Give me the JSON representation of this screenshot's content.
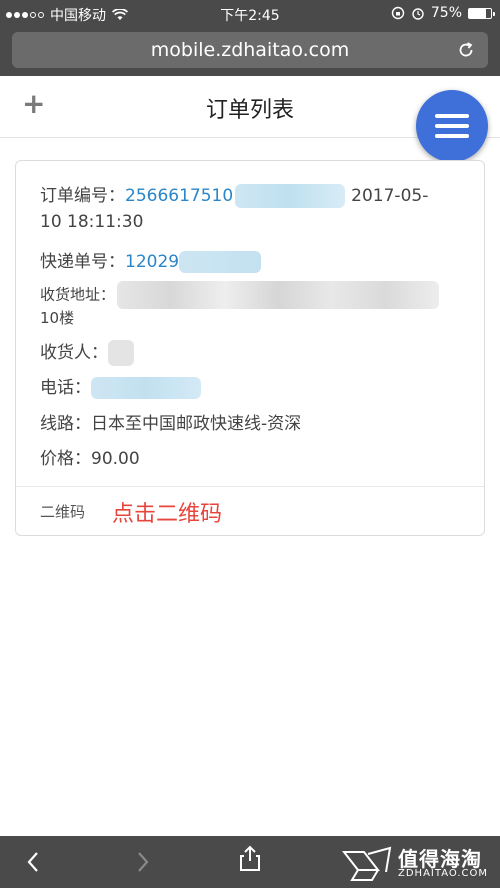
{
  "status_bar": {
    "carrier": "中国移动",
    "time": "下午2:45",
    "battery": "75%",
    "battery_level": 0.75
  },
  "browser": {
    "url": "mobile.zdhaitao.com"
  },
  "header": {
    "title": "订单列表"
  },
  "order": {
    "order_no_label": "订单编号：",
    "order_no_value": "2566617510",
    "order_time_part1": "2017-05-",
    "order_time_part2": "10 18:11:30",
    "express_label": "快递单号：",
    "express_value": "12029",
    "address_label": "收货地址：",
    "address_tail": "10楼",
    "receiver_label": "收货人：",
    "phone_label": "电话：",
    "route_label": "线路：",
    "route_value": "日本至中国邮政快速线-资深",
    "price_label": "价格：",
    "price_value": "90.00",
    "qr_label": "二维码",
    "qr_link": "点击二维码"
  },
  "watermark": {
    "text": "值得海淘",
    "sub": "ZDHAITAO.COM"
  }
}
